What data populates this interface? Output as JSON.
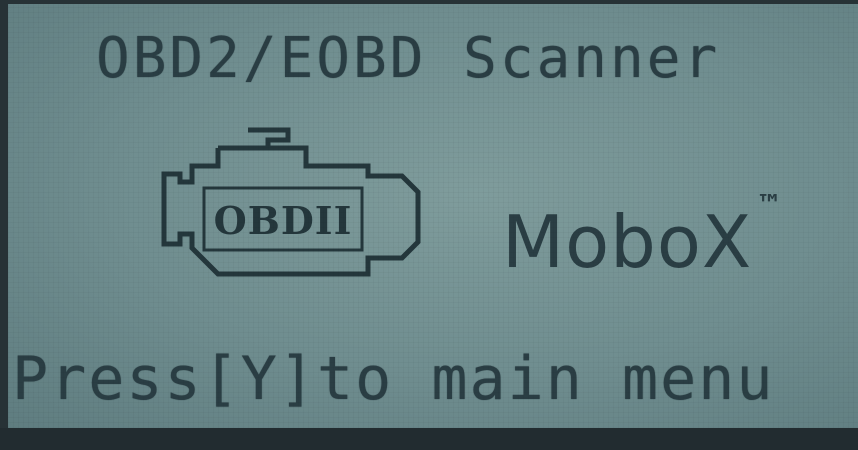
{
  "screen": {
    "title": "OBD2/EOBD Scanner",
    "engine_icon_label": "OBDII",
    "brand": "MoboX",
    "trademark": "™",
    "prompt": "Press[Y]to main menu"
  },
  "colors": {
    "lcd_background": "#7f9c9c",
    "lcd_text": "#2a3e44",
    "bezel": "#273236"
  },
  "icons": [
    "check-engine-icon"
  ]
}
